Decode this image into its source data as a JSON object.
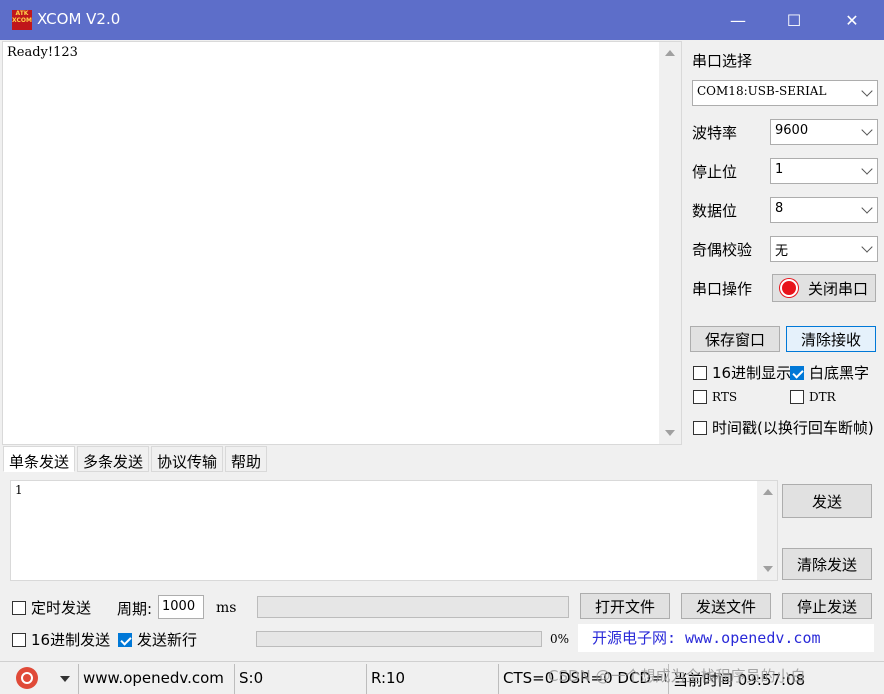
{
  "window": {
    "logo_text": "ATK XCOM",
    "title": "XCOM V2.0",
    "minimize": "—",
    "maximize": "☐",
    "close": "✕"
  },
  "receive": {
    "text": "Ready!123"
  },
  "side": {
    "port_select_label": "串口选择",
    "port_value": "COM18:USB-SERIAL",
    "baud_label": "波特率",
    "baud_value": "9600",
    "stop_label": "停止位",
    "stop_value": "1",
    "data_label": "数据位",
    "data_value": "8",
    "parity_label": "奇偶校验",
    "parity_value": "无",
    "op_label": "串口操作",
    "op_button": "关闭串口",
    "save_window": "保存窗口",
    "clear_receive": "清除接收",
    "hex_display": "16进制显示",
    "white_black": "白底黑字",
    "rts": "RTS",
    "dtr": "DTR",
    "timestamp": "时间戳(以换行回车断帧)"
  },
  "tabs": [
    "单条发送",
    "多条发送",
    "协议传输",
    "帮助"
  ],
  "send": {
    "text": "1",
    "send_button": "发送",
    "clear_send": "清除发送",
    "timed_send": "定时发送",
    "period_label": "周期:",
    "period_value": "1000",
    "ms": "ms",
    "open_file": "打开文件",
    "send_file": "发送文件",
    "stop_send": "停止发送",
    "hex_send": "16进制发送",
    "send_newline": "发送新行",
    "progress_text": "0%",
    "progress": 0,
    "site": "开源电子网: www.openedv.com"
  },
  "status": {
    "url": "www.openedv.com",
    "sent": "S:0",
    "received": "R:10",
    "signals": "CTS=0 DSR=0 DCD=0",
    "time": "当前时间 09:57:08",
    "watermark": "CSDN @一个想成为全栈程序员的小白"
  },
  "colors": {
    "titlebar": "#5d6ec9",
    "accent": "#0078d7",
    "port_icon": "#e8141b"
  }
}
